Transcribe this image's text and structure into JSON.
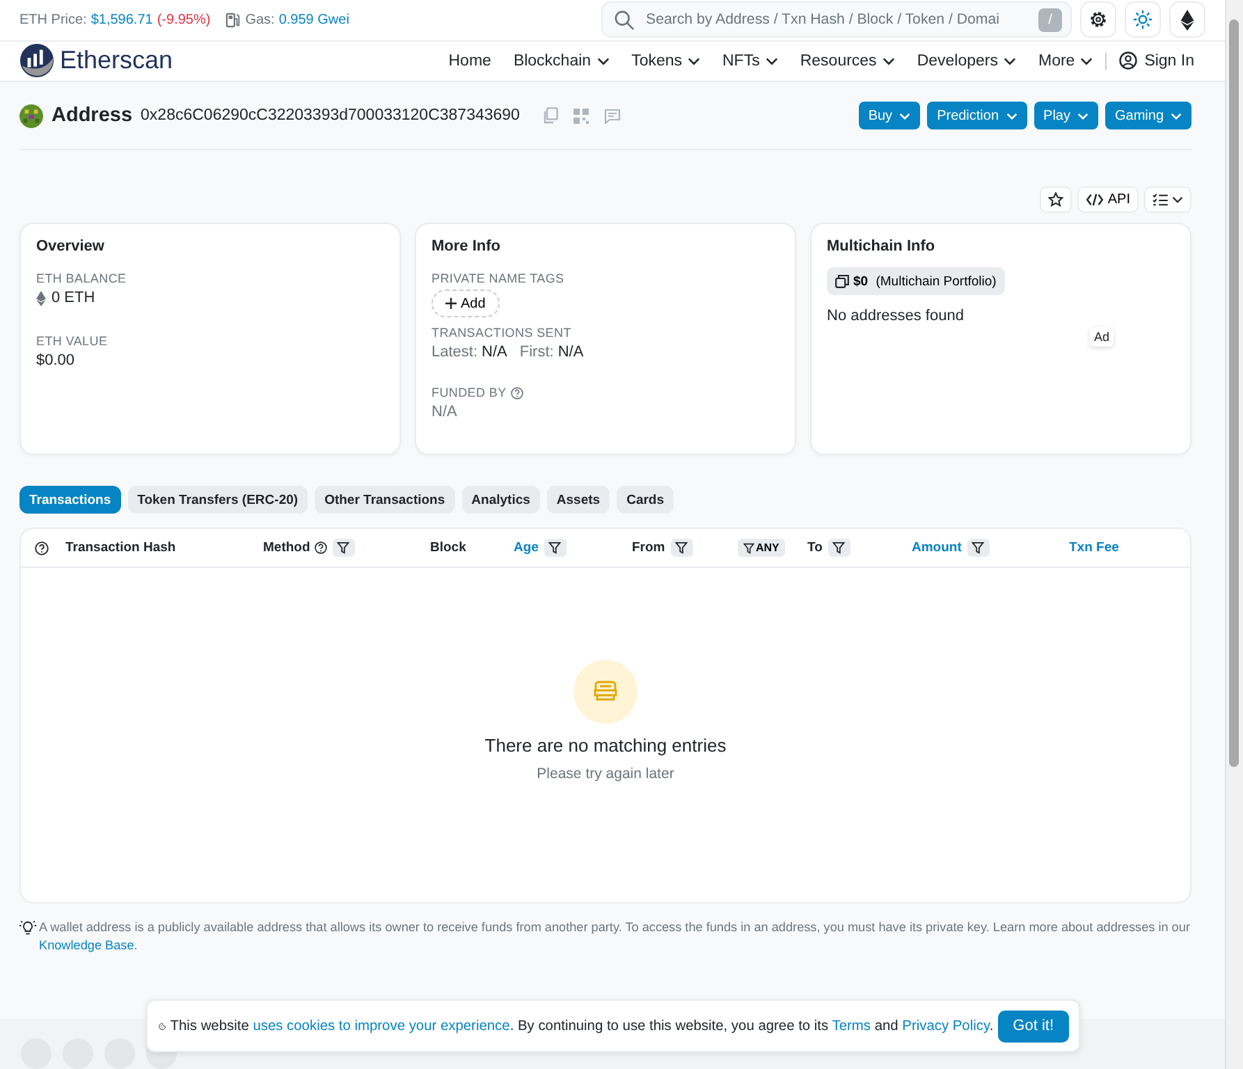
{
  "topbar": {
    "eth_price_label": "ETH Price:",
    "eth_price": "$1,596.71",
    "eth_change": "(-9.95%)",
    "gas_label": "Gas:",
    "gas_value": "0.959 Gwei",
    "search": {
      "placeholder": "Search by Address / Txn Hash / Block / Token / Domai"
    },
    "search_key": "/"
  },
  "nav": {
    "logo_text": "Etherscan",
    "items": [
      {
        "label": "Home",
        "dropdown": false
      },
      {
        "label": "Blockchain",
        "dropdown": true
      },
      {
        "label": "Tokens",
        "dropdown": true
      },
      {
        "label": "NFTs",
        "dropdown": true
      },
      {
        "label": "Resources",
        "dropdown": true
      },
      {
        "label": "Developers",
        "dropdown": true
      },
      {
        "label": "More",
        "dropdown": true
      }
    ],
    "sign_in": "Sign In"
  },
  "address": {
    "title": "Address",
    "hash": "0x28c6C06290cC32203393d700033120C387343690",
    "buttons": [
      "Buy",
      "Prediction",
      "Play",
      "Gaming"
    ]
  },
  "toolbar": {
    "api": "API"
  },
  "overview": {
    "title": "Overview",
    "balance_label": "ETH BALANCE",
    "balance": "0 ETH",
    "value_label": "ETH VALUE",
    "value": "$0.00"
  },
  "more_info": {
    "title": "More Info",
    "tags_label": "PRIVATE NAME TAGS",
    "add": "Add",
    "sent_label": "TRANSACTIONS SENT",
    "latest_label": "Latest:",
    "latest": "N/A",
    "first_label": "First:",
    "first": "N/A",
    "funded_label": "FUNDED BY",
    "funded": "N/A"
  },
  "multichain": {
    "title": "Multichain Info",
    "portfolio_value": "$0",
    "portfolio_label": "(Multichain Portfolio)",
    "empty": "No addresses found",
    "ad": "Ad"
  },
  "tabs": [
    {
      "label": "Transactions",
      "selected": true
    },
    {
      "label": "Token Transfers (ERC-20)",
      "selected": false
    },
    {
      "label": "Other Transactions",
      "selected": false
    },
    {
      "label": "Analytics",
      "selected": false
    },
    {
      "label": "Assets",
      "selected": false
    },
    {
      "label": "Cards",
      "selected": false
    }
  ],
  "table": {
    "columns": [
      {
        "kind": "help"
      },
      {
        "kind": "text",
        "label": "Transaction Hash",
        "link": false,
        "help": false,
        "filter": false
      },
      {
        "kind": "text",
        "label": "Method",
        "link": false,
        "help": true,
        "filter": true
      },
      {
        "kind": "text",
        "label": "Block",
        "link": false,
        "help": false,
        "filter": false
      },
      {
        "kind": "text",
        "label": "Age",
        "link": true,
        "help": false,
        "filter": true
      },
      {
        "kind": "text",
        "label": "From",
        "link": false,
        "help": false,
        "filter": true
      },
      {
        "kind": "chip",
        "label": "ANY"
      },
      {
        "kind": "text",
        "label": "To",
        "link": false,
        "help": false,
        "filter": true
      },
      {
        "kind": "text",
        "label": "Amount",
        "link": true,
        "help": false,
        "filter": true
      },
      {
        "kind": "text",
        "label": "Txn Fee",
        "link": true,
        "help": false,
        "filter": false
      }
    ],
    "empty_title": "There are no matching entries",
    "empty_hint": "Please try again later"
  },
  "note": {
    "text": "A wallet address is a publicly available address that allows its owner to receive funds from another party. To access the funds in an address, you must have its private key. Learn more about addresses in our",
    "link": "Knowledge Base",
    "end": "."
  },
  "cookie": {
    "parts": [
      {
        "kind": "text",
        "text": "This website "
      },
      {
        "kind": "link",
        "text": "uses cookies to improve your experience"
      },
      {
        "kind": "text",
        "text": ". By continuing to use this website, you agree to its "
      },
      {
        "kind": "link",
        "text": "Terms"
      },
      {
        "kind": "text",
        "text": " and "
      },
      {
        "kind": "link",
        "text": "Privacy Policy"
      },
      {
        "kind": "text",
        "text": "."
      }
    ],
    "button": "Got it!"
  }
}
